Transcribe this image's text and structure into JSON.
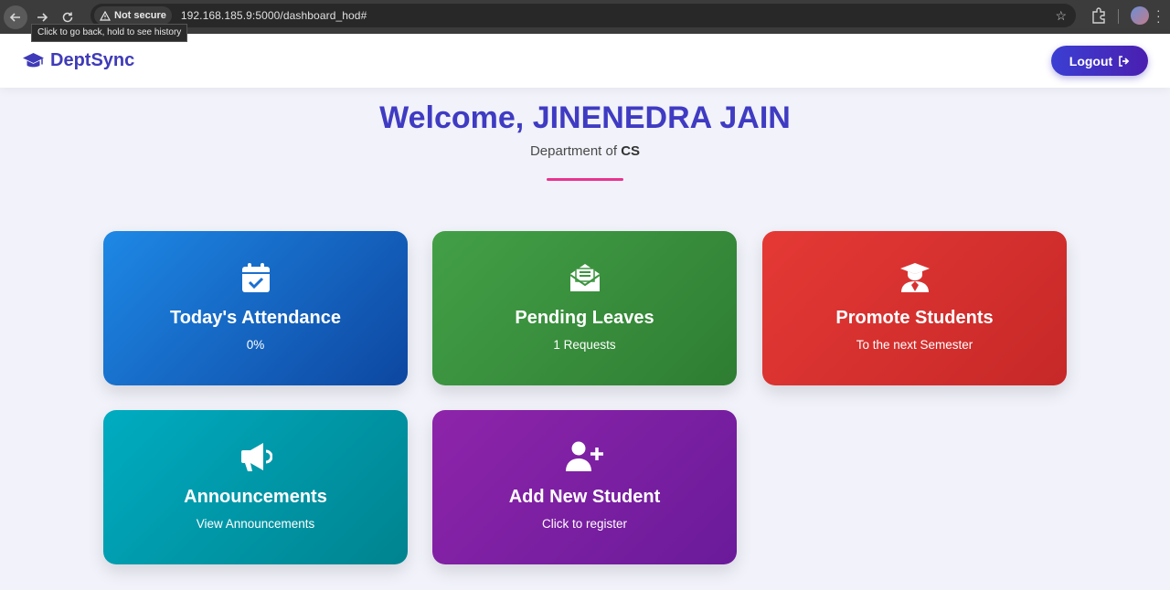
{
  "browser": {
    "security_label": "Not secure",
    "url": "192.168.185.9:5000/dashboard_hod#",
    "tooltip": "Click to go back, hold to see history"
  },
  "header": {
    "brand": "DeptSync",
    "logout_label": "Logout"
  },
  "welcome": {
    "title": "Welcome, JINENEDRA JAIN",
    "dept_prefix": "Department of",
    "dept_name": "CS"
  },
  "cards": [
    {
      "title": "Today's Attendance",
      "subtitle": "0%",
      "icon": "calendar-check-icon",
      "color": "#1565c0"
    },
    {
      "title": "Pending Leaves",
      "subtitle": "1 Requests",
      "icon": "envelope-open-icon",
      "color": "#388e3c"
    },
    {
      "title": "Promote Students",
      "subtitle": "To the next Semester",
      "icon": "graduate-icon",
      "color": "#d32f2f"
    },
    {
      "title": "Announcements",
      "subtitle": "View Announcements",
      "icon": "megaphone-icon",
      "color": "#0097a7"
    },
    {
      "title": "Add New Student",
      "subtitle": "Click to register",
      "icon": "user-plus-icon",
      "color": "#7b1fa2"
    }
  ],
  "colors": {
    "brand": "#3f3bb8",
    "accent_divider": "#e8338f"
  }
}
